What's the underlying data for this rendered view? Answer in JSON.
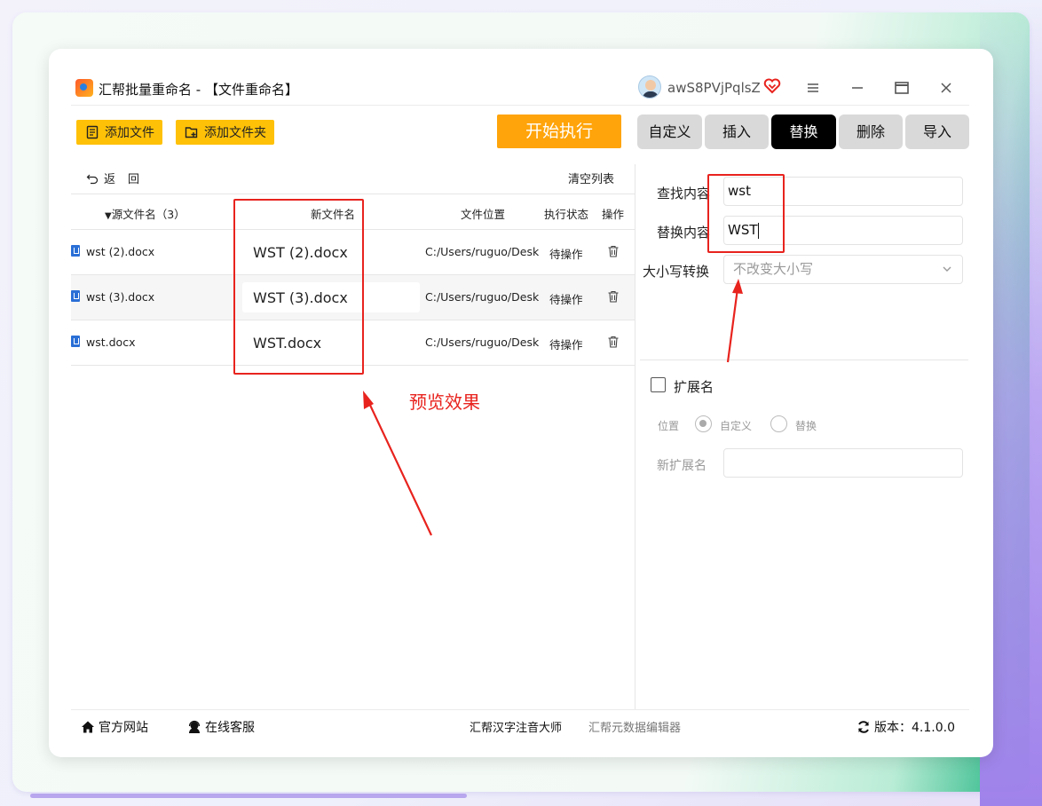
{
  "window": {
    "title": "汇帮批量重命名 - 【文件重命名】",
    "username": "awS8PVjPqlsZ"
  },
  "toolbar": {
    "add_file": "添加文件",
    "add_folder": "添加文件夹",
    "start": "开始执行"
  },
  "tabs": [
    {
      "label": "自定义",
      "active": false
    },
    {
      "label": "插入",
      "active": false
    },
    {
      "label": "替换",
      "active": true
    },
    {
      "label": "删除",
      "active": false
    },
    {
      "label": "导入",
      "active": false
    }
  ],
  "list": {
    "back": "返回",
    "clear": "清空列表",
    "headers": {
      "source": "源文件名（3）",
      "new_name": "新文件名",
      "location": "文件位置",
      "status": "执行状态",
      "action": "操作"
    },
    "rows": [
      {
        "source": "wst (2).docx",
        "new_name": "WST (2).docx",
        "location": "C:/Users/ruguo/Deskt",
        "status": "待操作"
      },
      {
        "source": "wst (3).docx",
        "new_name": "WST (3).docx",
        "location": "C:/Users/ruguo/Deskt",
        "status": "待操作"
      },
      {
        "source": "wst.docx",
        "new_name": "WST.docx",
        "location": "C:/Users/ruguo/Deskt",
        "status": "待操作"
      }
    ]
  },
  "replace": {
    "find_label": "查找内容",
    "find_value": "wst",
    "replace_label": "替换内容",
    "replace_value": "WST",
    "case_label": "大小写转换",
    "case_value": "不改变大小写",
    "ext_label": "扩展名",
    "position_label": "位置",
    "opt_custom": "自定义",
    "opt_replace": "替换",
    "new_ext_label": "新扩展名"
  },
  "footer": {
    "website": "官方网站",
    "support": "在线客服",
    "link1": "汇帮汉字注音大师",
    "link2": "汇帮元数据编辑器",
    "version": "版本：4.1.0.0"
  },
  "annotation": {
    "text": "预览效果"
  },
  "colors": {
    "accent_yellow": "#ffc107",
    "start_orange": "#ffa40a",
    "annotation_red": "#e8231e",
    "active_tab": "#000000"
  }
}
